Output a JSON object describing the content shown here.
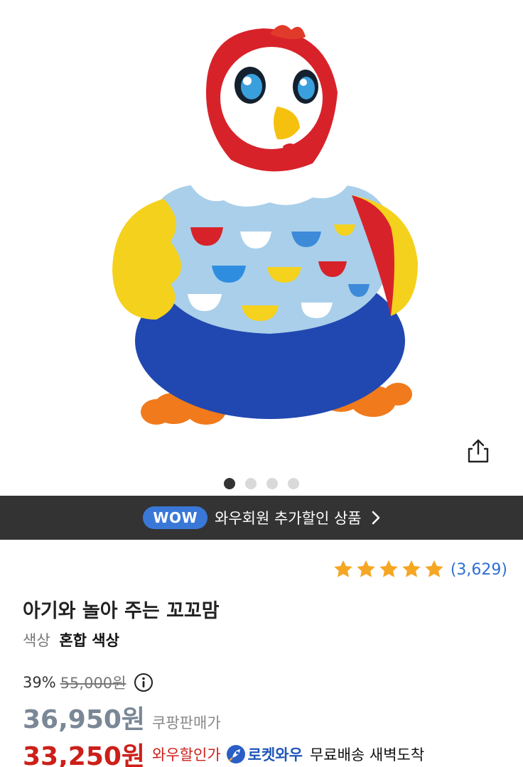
{
  "colors": {
    "wow_badge": "#3a78d8",
    "banner_bg": "#333333",
    "star": "#f5a623",
    "rating_link": "#2d6fd6",
    "wow_price": "#cc1f1a",
    "rocket": "#1f56b8"
  },
  "gallery": {
    "image_subject": "toy-hen",
    "slide_count": 4,
    "active_slide": 1,
    "share_icon": "share-icon"
  },
  "wow_banner": {
    "badge": "WOW",
    "text": "와우회원 추가할인 상품",
    "chevron_icon": "chevron-right-icon"
  },
  "product": {
    "rating_stars": 5,
    "rating_count": "(3,629)",
    "title": "아기와 놀아 주는 꼬꼬맘",
    "option_label": "색상",
    "option_value": "혼합 색상"
  },
  "pricing": {
    "discount": "39%",
    "original_price": "55,000원",
    "sale_price": "36,950원",
    "sale_label": "쿠팡판매가",
    "wow_price": "33,250원",
    "wow_label": "와우할인가",
    "rocket_label": "로켓와우",
    "delivery": "무료배송 새벽도착"
  }
}
